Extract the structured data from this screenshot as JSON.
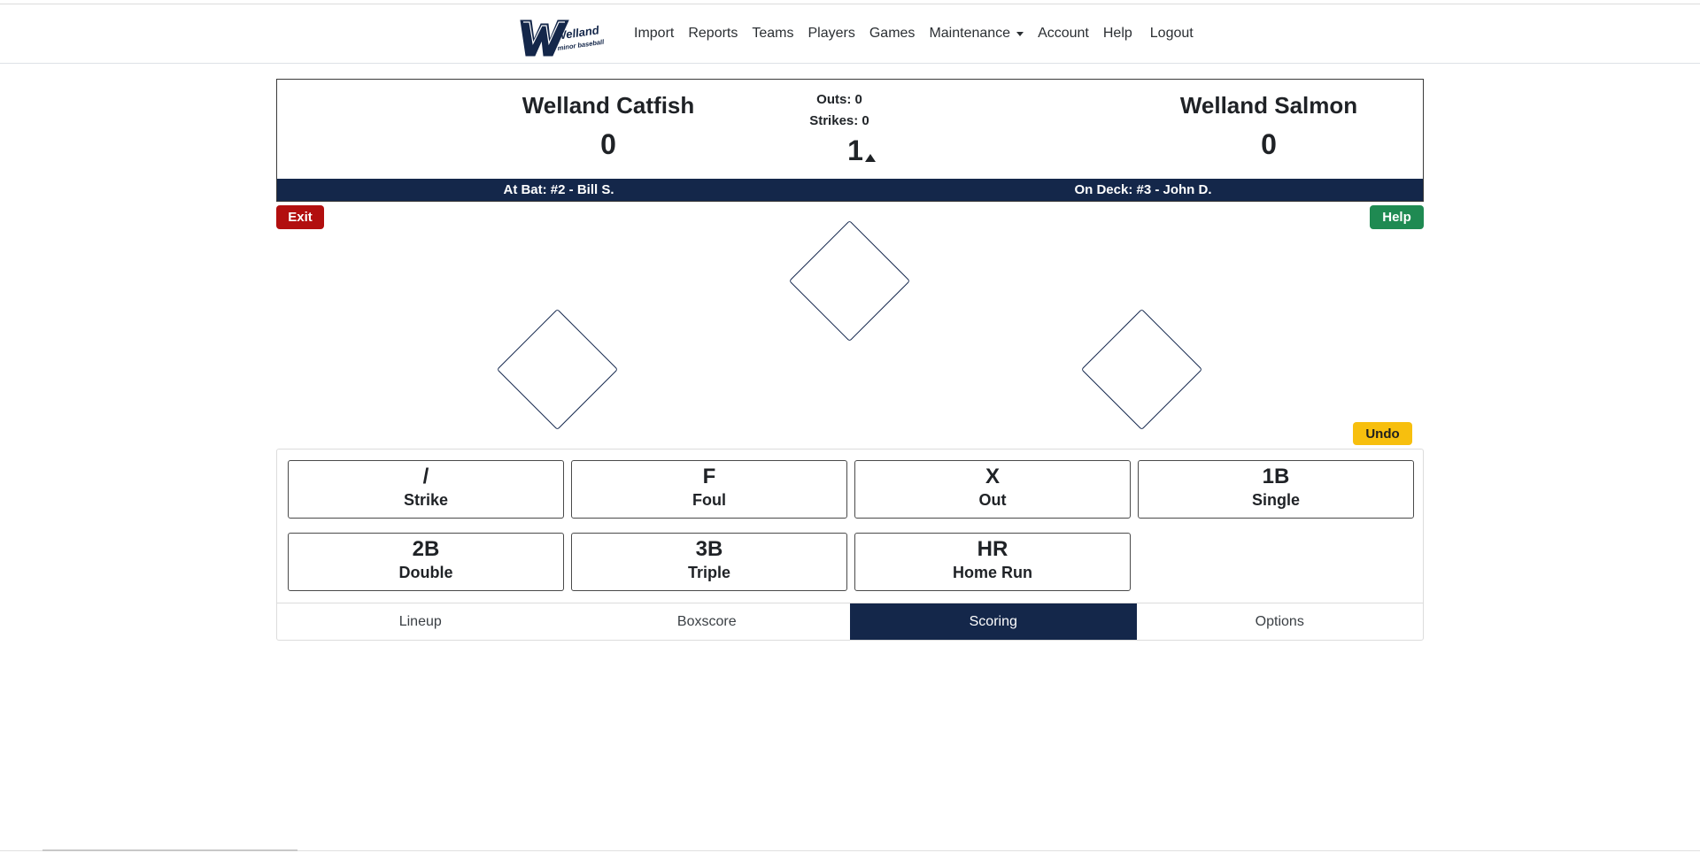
{
  "nav": {
    "logo_icon": "welland-minor-baseball-logo",
    "logo_text": "Welland",
    "logo_subtext": "minor baseball",
    "items": [
      "Import",
      "Reports",
      "Teams",
      "Players",
      "Games",
      "Maintenance",
      "Account",
      "Help",
      "Logout"
    ]
  },
  "scoreboard": {
    "away_team": "Welland Catfish",
    "away_score": "0",
    "home_team": "Welland Salmon",
    "home_score": "0",
    "outs": "Outs: 0",
    "strikes": "Strikes: 0",
    "inning": "1",
    "inning_half_icon": "top-half-arrow-icon",
    "at_bat": "At Bat: #2 - Bill S.",
    "on_deck": "On Deck: #3 - John D."
  },
  "controls": {
    "exit": "Exit",
    "help": "Help",
    "undo": "Undo"
  },
  "actions": [
    {
      "sym": "/",
      "label": "Strike"
    },
    {
      "sym": "F",
      "label": "Foul"
    },
    {
      "sym": "X",
      "label": "Out"
    },
    {
      "sym": "1B",
      "label": "Single"
    },
    {
      "sym": "2B",
      "label": "Double"
    },
    {
      "sym": "3B",
      "label": "Triple"
    },
    {
      "sym": "HR",
      "label": "Home Run"
    }
  ],
  "tabs": [
    "Lineup",
    "Boxscore",
    "Scoring",
    "Options"
  ],
  "active_tab": "Scoring",
  "colors": {
    "navy": "#14274a",
    "exit_red": "#b20f0f",
    "help_green": "#1f8a52",
    "undo_yellow": "#f7bf0e"
  }
}
